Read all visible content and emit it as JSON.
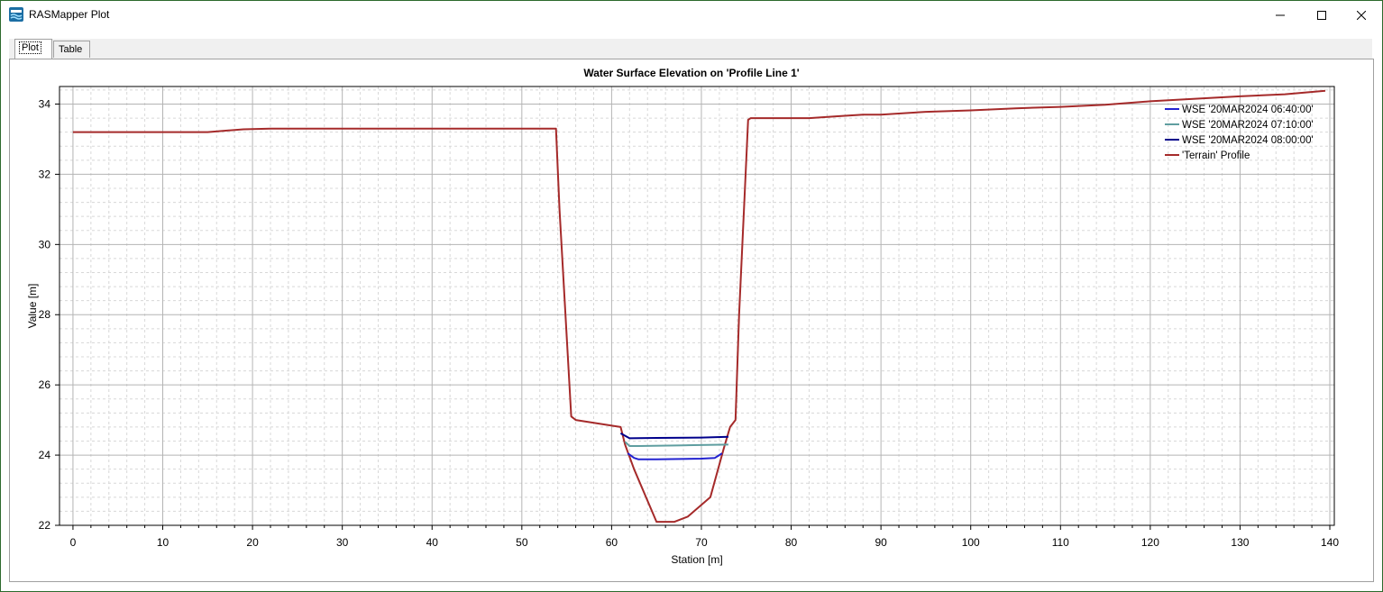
{
  "window": {
    "title": "RASMapper Plot"
  },
  "tabs": [
    {
      "label": "Plot",
      "active": true
    },
    {
      "label": "Table",
      "active": false
    }
  ],
  "chart_data": {
    "type": "line",
    "title": "Water Surface Elevation on 'Profile Line 1'",
    "xlabel": "Station [m]",
    "ylabel": "Value [m]",
    "xlim": [
      -1.5,
      140.5
    ],
    "ylim": [
      22,
      34.5
    ],
    "xticks": [
      0,
      10,
      20,
      30,
      40,
      50,
      60,
      70,
      80,
      90,
      100,
      110,
      120,
      130,
      140
    ],
    "yticks": [
      22,
      24,
      26,
      28,
      30,
      32,
      34
    ],
    "grid": true,
    "legend_position": "top-right",
    "series": [
      {
        "name": "WSE '20MAR2024 06:40:00'",
        "color": "#2222d0",
        "x": [
          61.8,
          62.5,
          63,
          65,
          70,
          71.5,
          72.3
        ],
        "y": [
          24.05,
          23.92,
          23.88,
          23.88,
          23.9,
          23.92,
          24.05
        ]
      },
      {
        "name": "WSE '20MAR2024 07:10:00'",
        "color": "#5f9ea0",
        "x": [
          61.5,
          62,
          63,
          68,
          73
        ],
        "y": [
          24.38,
          24.26,
          24.26,
          24.28,
          24.3
        ]
      },
      {
        "name": "WSE '20MAR2024 08:00:00'",
        "color": "#00008b",
        "x": [
          61.0,
          62,
          65,
          70,
          73
        ],
        "y": [
          24.62,
          24.48,
          24.49,
          24.5,
          24.52
        ]
      },
      {
        "name": "'Terrain' Profile",
        "color": "#a52a2a",
        "x": [
          0,
          10,
          15,
          19,
          22,
          30,
          40,
          50,
          53.8,
          54.2,
          55.5,
          56,
          60.5,
          61,
          61.5,
          62.5,
          65,
          67,
          68.5,
          71,
          72.5,
          73.2,
          73.8,
          74.2,
          75.2,
          75.5,
          82,
          85,
          88,
          90,
          95,
          100,
          105,
          110,
          115,
          120,
          125,
          130,
          135,
          139.5
        ],
        "y": [
          33.2,
          33.2,
          33.2,
          33.28,
          33.3,
          33.3,
          33.3,
          33.3,
          33.3,
          31.0,
          25.1,
          25.0,
          24.82,
          24.8,
          24.3,
          23.6,
          22.1,
          22.1,
          22.25,
          22.8,
          24.2,
          24.8,
          25.0,
          28.0,
          33.55,
          33.6,
          33.6,
          33.65,
          33.7,
          33.7,
          33.78,
          33.82,
          33.88,
          33.92,
          33.98,
          34.08,
          34.15,
          34.22,
          34.28,
          34.38
        ]
      }
    ]
  }
}
